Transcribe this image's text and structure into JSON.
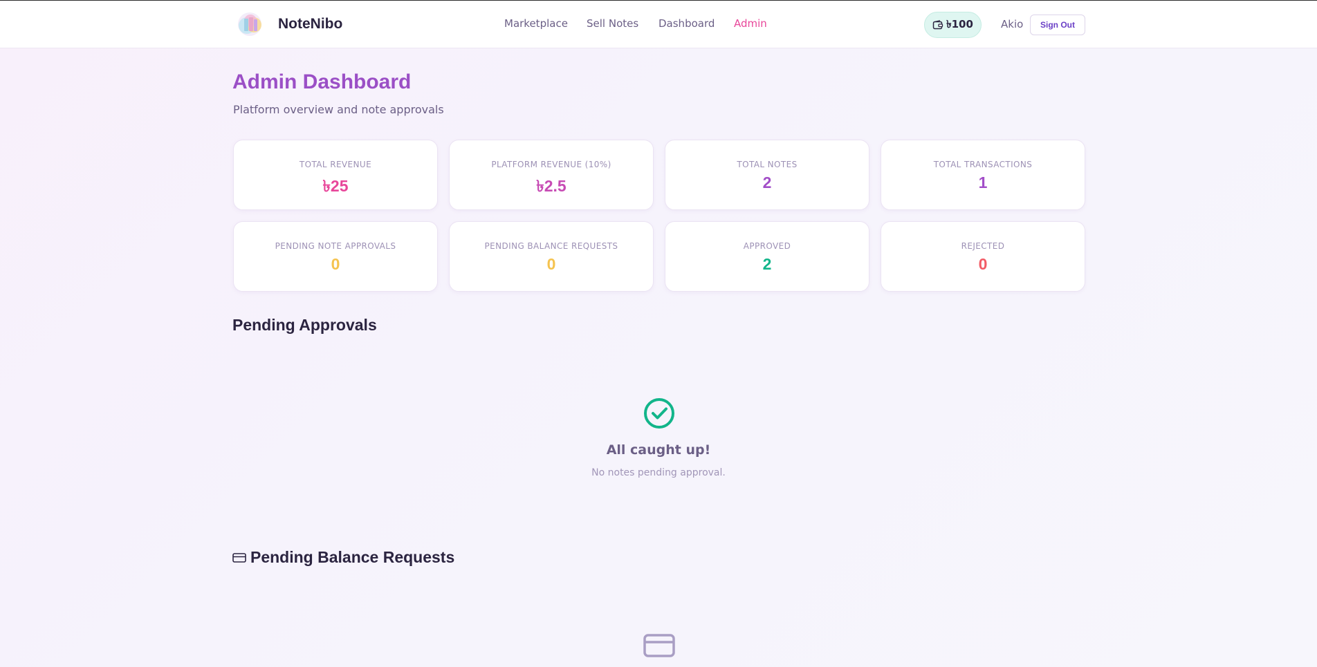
{
  "header": {
    "brand": "NoteNibo",
    "nav": [
      {
        "label": "Marketplace",
        "active": false
      },
      {
        "label": "Sell Notes",
        "active": false
      },
      {
        "label": "Dashboard",
        "active": false
      },
      {
        "label": "Admin",
        "active": true
      }
    ],
    "wallet_balance": "৳100",
    "username": "Akio",
    "signout_label": "Sign Out"
  },
  "page": {
    "title": "Admin Dashboard",
    "subtitle": "Platform overview and note approvals"
  },
  "stats": [
    {
      "label": "Total Revenue",
      "value": "৳25",
      "color": "#e8469a"
    },
    {
      "label": "Platform Revenue (10%)",
      "value": "৳2.5",
      "color": "#c74bb4"
    },
    {
      "label": "Total Notes",
      "value": "2",
      "color": "#a24ec8"
    },
    {
      "label": "Total Transactions",
      "value": "1",
      "color": "#a24ec8"
    },
    {
      "label": "Pending Note Approvals",
      "value": "0",
      "color": "#f5c34f"
    },
    {
      "label": "Pending Balance Requests",
      "value": "0",
      "color": "#f5c34f"
    },
    {
      "label": "Approved",
      "value": "2",
      "color": "#12b58a"
    },
    {
      "label": "Rejected",
      "value": "0",
      "color": "#f25c66"
    }
  ],
  "pending_approvals": {
    "title": "Pending Approvals",
    "empty_title": "All caught up!",
    "empty_text": "No notes pending approval."
  },
  "pending_balance": {
    "title": "Pending Balance Requests"
  },
  "colors": {
    "accent_pink": "#e8469a",
    "accent_purple": "#9b4fc6",
    "success": "#12b58a"
  }
}
